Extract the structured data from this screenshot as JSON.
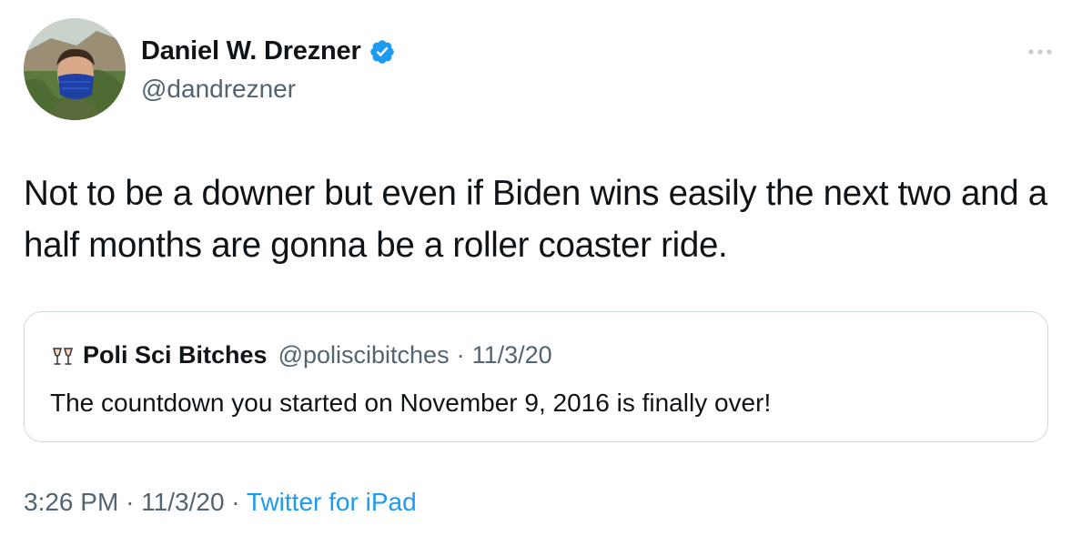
{
  "author": {
    "display_name": "Daniel W. Drezner",
    "handle": "@dandrezner",
    "verified": true
  },
  "tweet": {
    "text": "Not to be a downer but even if Biden wins easily the next two and a half months are gonna be a roller coaster ride."
  },
  "quote": {
    "avatar_icon": "wine-glasses-icon",
    "display_name": "Poli Sci Bitches",
    "handle": "@poliscibitches",
    "separator": "·",
    "date": "11/3/20",
    "text": "The countdown you started on November 9, 2016 is finally over!"
  },
  "meta": {
    "time": "3:26 PM",
    "separator": "·",
    "date": "11/3/20",
    "source": "Twitter for iPad"
  },
  "colors": {
    "text_primary": "#0f1419",
    "text_secondary": "#536471",
    "accent": "#1d9bf0",
    "border": "#cfd9de"
  }
}
